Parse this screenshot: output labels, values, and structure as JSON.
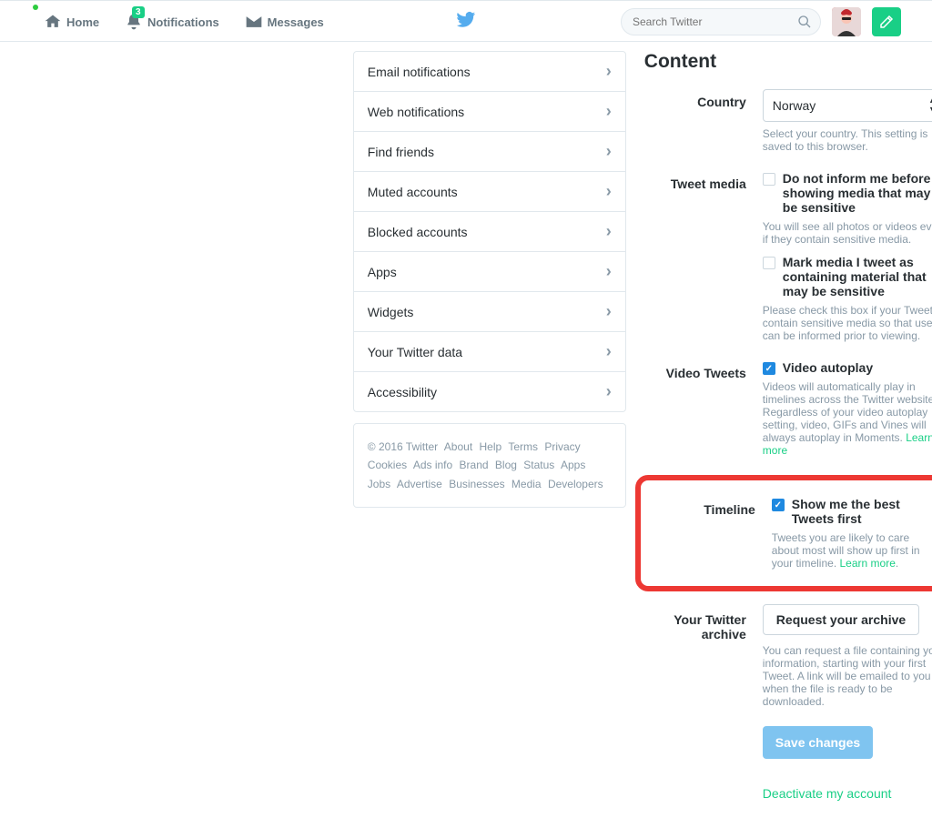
{
  "nav": {
    "home": "Home",
    "notifications": "Notifications",
    "notif_count": "3",
    "messages": "Messages",
    "search_placeholder": "Search Twitter"
  },
  "sidebar": {
    "items": [
      {
        "label": "Email notifications"
      },
      {
        "label": "Web notifications"
      },
      {
        "label": "Find friends"
      },
      {
        "label": "Muted accounts"
      },
      {
        "label": "Blocked accounts"
      },
      {
        "label": "Apps"
      },
      {
        "label": "Widgets"
      },
      {
        "label": "Your Twitter data"
      },
      {
        "label": "Accessibility"
      }
    ]
  },
  "footer": {
    "copyright": "© 2016 Twitter",
    "links": [
      "About",
      "Help",
      "Terms",
      "Privacy",
      "Cookies",
      "Ads info",
      "Brand",
      "Blog",
      "Status",
      "Apps",
      "Jobs",
      "Advertise",
      "Businesses",
      "Media",
      "Developers"
    ]
  },
  "content": {
    "title": "Content",
    "country": {
      "label": "Country",
      "value": "Norway",
      "help": "Select your country. This setting is saved to this browser."
    },
    "tweet_media": {
      "label": "Tweet media",
      "opt1_label": "Do not inform me before showing media that may be sensitive",
      "opt1_help": "You will see all photos or videos even if they contain sensitive media.",
      "opt2_label": "Mark media I tweet as containing material that may be sensitive",
      "opt2_help": "Please check this box if your Tweets contain sensitive media so that users can be informed prior to viewing."
    },
    "video": {
      "label": "Video Tweets",
      "opt_label": "Video autoplay",
      "help": "Videos will automatically play in timelines across the Twitter website. Regardless of your video autoplay setting, video, GIFs and Vines will always autoplay in Moments. ",
      "learn": "Learn more"
    },
    "timeline": {
      "label": "Timeline",
      "opt_label": "Show me the best Tweets first",
      "help": "Tweets you are likely to care about most will show up first in your timeline. ",
      "learn": "Learn more"
    },
    "archive": {
      "label": "Your Twitter archive",
      "button": "Request your archive",
      "help": "You can request a file containing your information, starting with your first Tweet. A link will be emailed to you when the file is ready to be downloaded."
    },
    "save_button": "Save changes",
    "deactivate": "Deactivate my account"
  }
}
